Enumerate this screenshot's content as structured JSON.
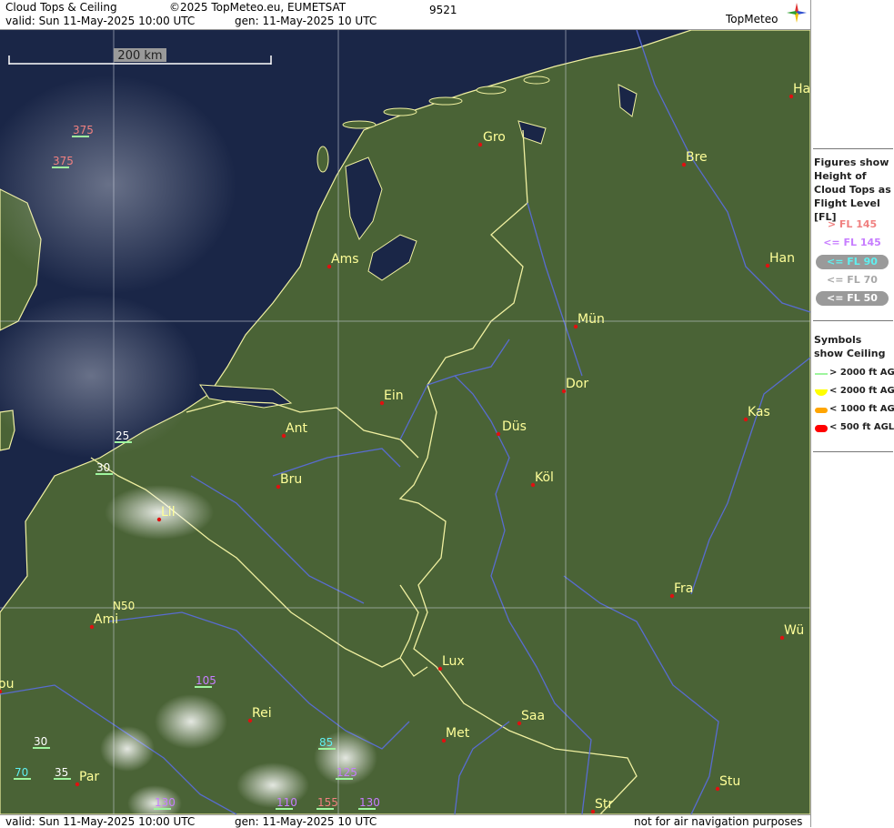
{
  "header": {
    "product_title": "Cloud Tops & Ceiling",
    "copyright": "©2025 TopMeteo.eu, EUMETSAT",
    "stamp": "9521",
    "valid": "valid:  Sun  11-May-2025  10:00 UTC",
    "generated": "gen: 11-May-2025 10 UTC",
    "logo": "TopMeteo"
  },
  "footer": {
    "valid": "valid:  Sun  11-May-2025  10:00 UTC",
    "generated": "gen: 11-May-2025 10 UTC",
    "disclaimer": "not for air navigation purposes"
  },
  "map": {
    "scale_bar_label": "200 km",
    "latitude_label": "N50",
    "cities": [
      "Gro",
      "Bre",
      "Ha",
      "Ams",
      "Han",
      "Mün",
      "Dor",
      "Ein",
      "Ant",
      "Kas",
      "Düs",
      "Bru",
      "Köl",
      "Lil",
      "Ami",
      "Fra",
      "Wü",
      "Lux",
      "Rei",
      "Saa",
      "Met",
      "Par",
      "Stu",
      "Str",
      "ou"
    ],
    "cloud_top_figures": [
      {
        "value": "375",
        "class": "above_fl145"
      },
      {
        "value": "375",
        "class": "above_fl145"
      },
      {
        "value": "25",
        "class": "le_fl50"
      },
      {
        "value": "30",
        "class": "le_fl50"
      },
      {
        "value": "105",
        "class": "le_fl145"
      },
      {
        "value": "85",
        "class": "le_fl90"
      },
      {
        "value": "30",
        "class": "le_fl50"
      },
      {
        "value": "70",
        "class": "le_fl90"
      },
      {
        "value": "35",
        "class": "le_fl50"
      },
      {
        "value": "125",
        "class": "le_fl145"
      },
      {
        "value": "130",
        "class": "le_fl145"
      },
      {
        "value": "110",
        "class": "le_fl145"
      },
      {
        "value": "155",
        "class": "above_fl145"
      },
      {
        "value": "130",
        "class": "le_fl145"
      }
    ]
  },
  "legend": {
    "figures_title": "Figures show Height of Cloud Tops as Flight Level  [FL]",
    "flight_levels": [
      {
        "label": "> FL 145",
        "color": "#f08080"
      },
      {
        "label": "<= FL 145",
        "color": "#c77dff"
      },
      {
        "label": "<= FL 90",
        "color": "#5ff0f0"
      },
      {
        "label": "<= FL 70",
        "color": "#a8a8a8"
      },
      {
        "label": "<= FL 50",
        "color": "#ffffff"
      }
    ],
    "symbols_title": "Symbols show Ceiling",
    "ceiling": [
      {
        "label": "> 2000 ft AGL",
        "color": "#9ef59e"
      },
      {
        "label": "< 2000 ft AGL",
        "color": "#ffff00"
      },
      {
        "label": "< 1000 ft AGL",
        "color": "#ffa500"
      },
      {
        "label": "< 500 ft AGL",
        "color": "#ff0000"
      }
    ]
  },
  "colors": {
    "sea": "#1a2647",
    "land": "#4a6336",
    "border": "#f0f0a0",
    "river": "#5a6de0",
    "city_label": "#ffff99",
    "city_dot": "#e01010"
  }
}
